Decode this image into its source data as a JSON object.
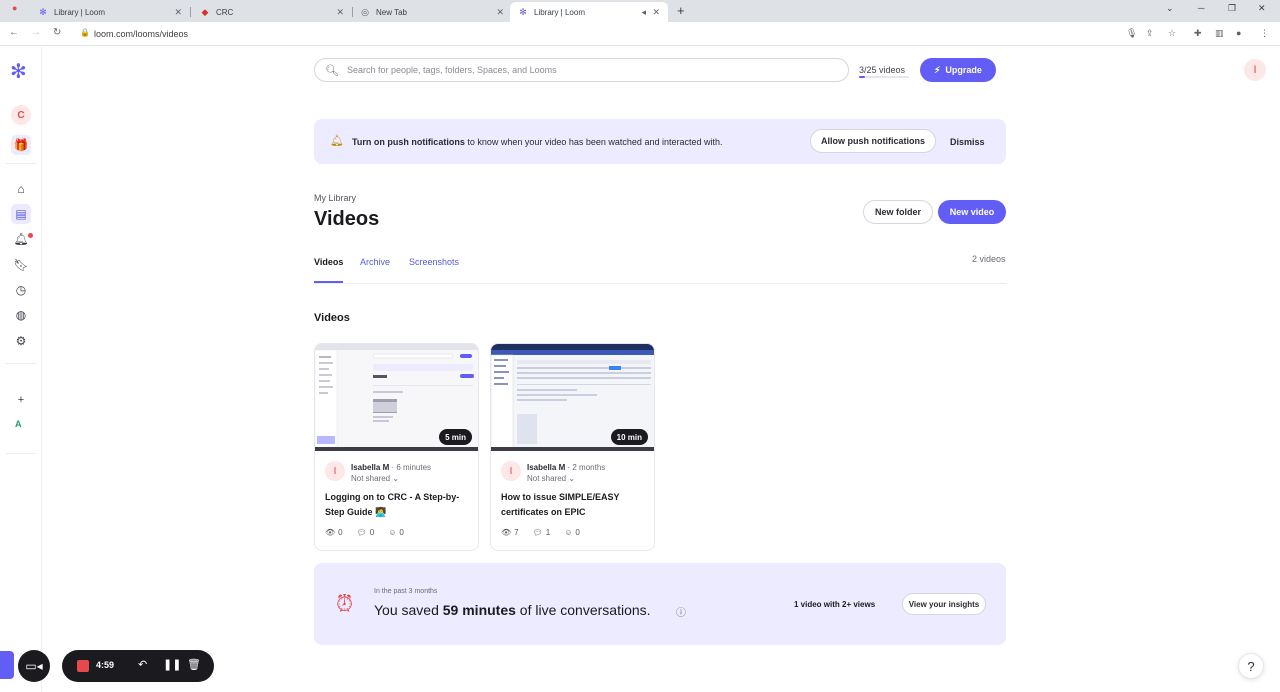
{
  "browser": {
    "tabs": [
      {
        "label": "Library | Loom",
        "active": false
      },
      {
        "label": "CRC",
        "active": false
      },
      {
        "label": "New Tab",
        "active": false
      },
      {
        "label": "Library | Loom",
        "active": true
      }
    ],
    "url": "loom.com/looms/videos"
  },
  "colors": {
    "brand": "#625df5",
    "banner": "#ecebff",
    "avatar_bg": "#fde7e7",
    "avatar_fg": "#e5484d"
  },
  "rail": {
    "avatar_letter": "C",
    "workspace_letter": "A",
    "items": [
      "home-icon",
      "library-icon",
      "bell-icon",
      "bookmark-icon",
      "history-icon",
      "globe-icon",
      "gear-icon"
    ]
  },
  "top": {
    "search_placeholder": "Search for people, tags, folders, Spaces, and Looms",
    "quota_label": "3/25 videos",
    "quota_fraction": 0.12,
    "upgrade_label": "Upgrade",
    "avatar_letter": "I"
  },
  "banner": {
    "bold_text": "Turn on push notifications",
    "text": " to know when your video has been watched and interacted with.",
    "allow_label": "Allow push notifications",
    "dismiss_label": "Dismiss"
  },
  "header": {
    "breadcrumb": "My Library",
    "title": "Videos",
    "new_folder_label": "New folder",
    "new_video_label": "New video"
  },
  "tabs": {
    "items": [
      "Videos",
      "Archive",
      "Screenshots"
    ],
    "count": "2 videos"
  },
  "section_title": "Videos",
  "videos": [
    {
      "duration": "5 min",
      "avatar_letter": "I",
      "author": "Isabella M",
      "age": "· 6 minutes",
      "sharing": "Not shared",
      "title": "Logging on to CRC - A Step-by-Step Guide 👩‍💻",
      "views": "0",
      "comments": "0",
      "reactions": "0"
    },
    {
      "duration": "10 min",
      "avatar_letter": "I",
      "author": "Isabella M",
      "age": "· 2 months",
      "sharing": "Not shared",
      "title": "How to issue SIMPLE/EASY certificates on EPIC",
      "views": "7",
      "comments": "1",
      "reactions": "0"
    }
  ],
  "insights": {
    "period": "In the past 3 months",
    "prefix": "You saved ",
    "minutes": "59 minutes",
    "suffix": " of live conversations.",
    "views_summary": "1 video with 2+ views",
    "button_label": "View your insights"
  },
  "recorder": {
    "time": "4:59"
  }
}
